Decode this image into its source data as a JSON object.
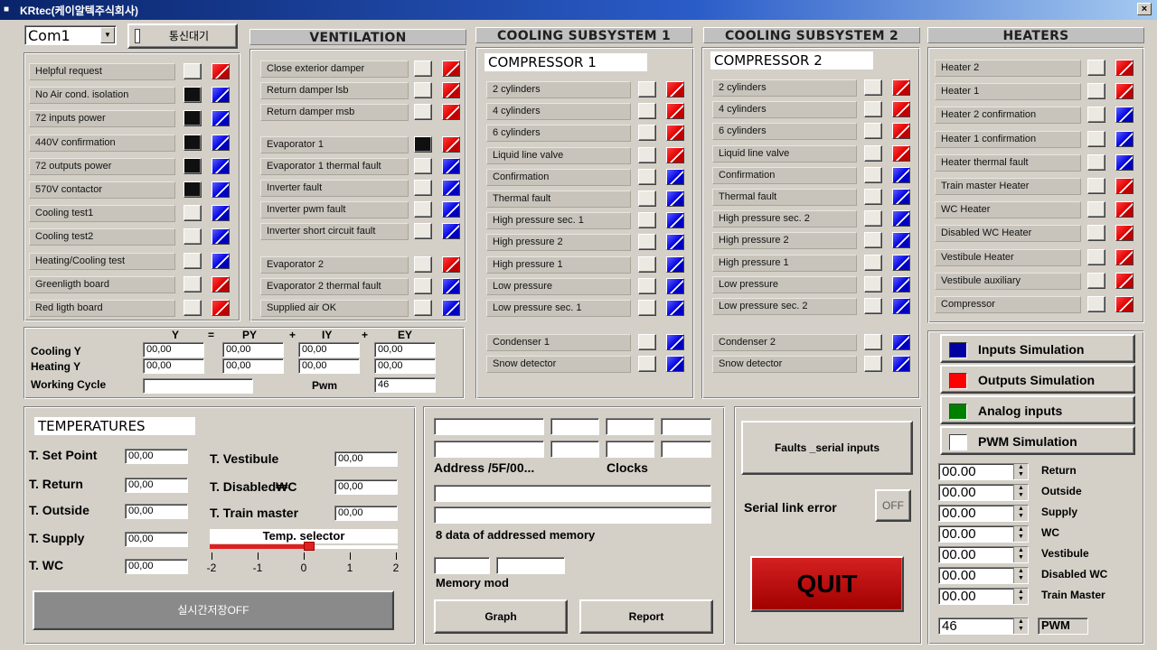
{
  "window": {
    "title": "KRtec(케이알텍주식회사)",
    "close_glyph": "×"
  },
  "top": {
    "port_value": "Com1",
    "comm_button": "통신대기"
  },
  "left_list": [
    {
      "label": "Helpful request",
      "sq": "off",
      "led": "red"
    },
    {
      "label": "No Air cond. isolation",
      "sq": "on",
      "led": "blue"
    },
    {
      "label": "72 inputs power",
      "sq": "on",
      "led": "blue"
    },
    {
      "label": "440V confirmation",
      "sq": "on",
      "led": "blue"
    },
    {
      "label": "72 outputs power",
      "sq": "on",
      "led": "blue"
    },
    {
      "label": "570V contactor",
      "sq": "on",
      "led": "blue"
    },
    {
      "label": "Cooling test1",
      "sq": "off",
      "led": "blue"
    },
    {
      "label": "Cooling test2",
      "sq": "off",
      "led": "blue"
    },
    {
      "label": "Heating/Cooling test",
      "sq": "off",
      "led": "blue"
    },
    {
      "label": "Greenligth board",
      "sq": "off",
      "led": "red"
    },
    {
      "label": "Red ligth board",
      "sq": "off",
      "led": "red"
    }
  ],
  "ventilation": {
    "title": "VENTILATION",
    "groups": [
      [
        {
          "label": "Close exterior damper",
          "sq": "off",
          "led": "red"
        },
        {
          "label": "Return damper lsb",
          "sq": "off",
          "led": "red"
        },
        {
          "label": "Return damper msb",
          "sq": "off",
          "led": "red"
        }
      ],
      [
        {
          "label": "Evaporator 1",
          "sq": "on",
          "led": "red"
        },
        {
          "label": "Evaporator 1 thermal fault",
          "sq": "off",
          "led": "blue"
        },
        {
          "label": "Inverter fault",
          "sq": "off",
          "led": "blue"
        },
        {
          "label": "Inverter pwm fault",
          "sq": "off",
          "led": "blue"
        },
        {
          "label": "Inverter short circuit fault",
          "sq": "off",
          "led": "blue"
        }
      ],
      [
        {
          "label": "Evaporator 2",
          "sq": "off",
          "led": "red"
        },
        {
          "label": "Evaporator 2 thermal fault",
          "sq": "off",
          "led": "blue"
        },
        {
          "label": "Supplied air OK",
          "sq": "off",
          "led": "blue"
        }
      ]
    ]
  },
  "cooling1": {
    "title": "COOLING SUBSYSTEM 1",
    "compressor": "COMPRESSOR 1",
    "items": [
      {
        "label": "2 cylinders",
        "led": "red"
      },
      {
        "label": "4 cylinders",
        "led": "red"
      },
      {
        "label": "6 cylinders",
        "led": "red"
      },
      {
        "label": "Liquid line valve",
        "led": "red"
      },
      {
        "label": "Confirmation",
        "led": "blue"
      },
      {
        "label": "Thermal fault",
        "led": "blue"
      },
      {
        "label": "High pressure sec. 1",
        "led": "blue"
      },
      {
        "label": "High pressure 2",
        "led": "blue"
      },
      {
        "label": "High pressure 1",
        "led": "blue"
      },
      {
        "label": "Low pressure",
        "led": "blue"
      },
      {
        "label": "Low pressure sec. 1",
        "led": "blue"
      }
    ],
    "extra": [
      {
        "label": "Condenser 1",
        "led": "blue"
      },
      {
        "label": "Snow detector",
        "led": "blue"
      }
    ]
  },
  "cooling2": {
    "title": "COOLING SUBSYSTEM 2",
    "compressor": "COMPRESSOR 2",
    "items": [
      {
        "label": "2 cylinders",
        "led": "red"
      },
      {
        "label": "4 cylinders",
        "led": "red"
      },
      {
        "label": "6 cylinders",
        "led": "red"
      },
      {
        "label": "Liquid line valve",
        "led": "red"
      },
      {
        "label": "Confirmation",
        "led": "blue"
      },
      {
        "label": "Thermal fault",
        "led": "blue"
      },
      {
        "label": "High pressure sec. 2",
        "led": "blue"
      },
      {
        "label": "High pressure 2",
        "led": "blue"
      },
      {
        "label": "High pressure 1",
        "led": "blue"
      },
      {
        "label": "Low pressure",
        "led": "blue"
      },
      {
        "label": "Low pressure sec. 2",
        "led": "blue"
      }
    ],
    "extra": [
      {
        "label": "Condenser 2",
        "led": "blue"
      },
      {
        "label": "Snow detector",
        "led": "blue"
      }
    ]
  },
  "heaters": {
    "title": "HEATERS",
    "items": [
      {
        "label": "Heater 2",
        "led": "red"
      },
      {
        "label": "Heater 1",
        "led": "red"
      },
      {
        "label": "Heater 2 confirmation",
        "led": "blue"
      },
      {
        "label": "Heater 1 confirmation",
        "led": "blue"
      },
      {
        "label": "Heater thermal fault",
        "led": "blue"
      },
      {
        "label": "Train master Heater",
        "led": "red"
      },
      {
        "label": "WC Heater",
        "led": "red"
      },
      {
        "label": "Disabled WC Heater",
        "led": "red"
      },
      {
        "label": "Vestibule Heater",
        "led": "red"
      },
      {
        "label": "Vestibule auxiliary",
        "led": "red"
      },
      {
        "label": "Compressor",
        "led": "red"
      }
    ]
  },
  "pid": {
    "headers": [
      "Y",
      "=",
      "PY",
      "+",
      "IY",
      "+",
      "EY"
    ],
    "cooling_label": "Cooling Y",
    "heating_label": "Heating Y",
    "cooling": [
      "00,00",
      "00,00",
      "00,00",
      "00,00"
    ],
    "heating": [
      "00,00",
      "00,00",
      "00,00",
      "00,00"
    ],
    "working_cycle_label": "Working Cycle",
    "working_cycle_value": "",
    "pwm_label": "Pwm",
    "pwm_value": "46"
  },
  "temperatures": {
    "title": "TEMPERATURES",
    "left": [
      {
        "label": "T. Set Point",
        "value": "00,00"
      },
      {
        "label": "T. Return",
        "value": "00,00"
      },
      {
        "label": "T. Outside",
        "value": "00,00"
      },
      {
        "label": "T. Supply",
        "value": "00,00"
      },
      {
        "label": "T. WC",
        "value": "00,00"
      }
    ],
    "right": [
      {
        "label": "T. Vestibule",
        "value": "00,00"
      },
      {
        "label": "T. Disabled₩C",
        "value": "00,00"
      },
      {
        "label": "T. Train master",
        "value": "00,00"
      }
    ],
    "selector_label": "Temp. selector",
    "selector_ticks": [
      "-2",
      "-1",
      "0",
      "1",
      "2"
    ],
    "selector_value": 0,
    "save_button": "실시간저장OFF"
  },
  "memory": {
    "address_label": "Address /5F/00...",
    "clocks_label": "Clocks",
    "data_label": "8 data of addressed memory",
    "mod_label": "Memory mod",
    "graph_button": "Graph",
    "report_button": "Report"
  },
  "serial": {
    "faults_button": "Faults _serial inputs",
    "error_label": "Serial link error",
    "error_toggle": "OFF",
    "quit_button": "QUIT"
  },
  "simulation": {
    "buttons": [
      {
        "label": "Inputs  Simulation",
        "color": "#0000a0"
      },
      {
        "label": "Outputs Simulation",
        "color": "#ff0000"
      },
      {
        "label": "Analog inputs",
        "color": "#008000"
      },
      {
        "label": "PWM Simulation",
        "color": "#ffffff"
      }
    ],
    "analog": [
      {
        "value": "00.00",
        "label": "Return"
      },
      {
        "value": "00.00",
        "label": "Outside"
      },
      {
        "value": "00.00",
        "label": "Supply"
      },
      {
        "value": "00.00",
        "label": "WC"
      },
      {
        "value": "00.00",
        "label": "Vestibule"
      },
      {
        "value": "00.00",
        "label": "Disabled WC"
      },
      {
        "value": "00.00",
        "label": "Train Master"
      }
    ],
    "pwm_value": "46",
    "pwm_label": "PWM"
  }
}
